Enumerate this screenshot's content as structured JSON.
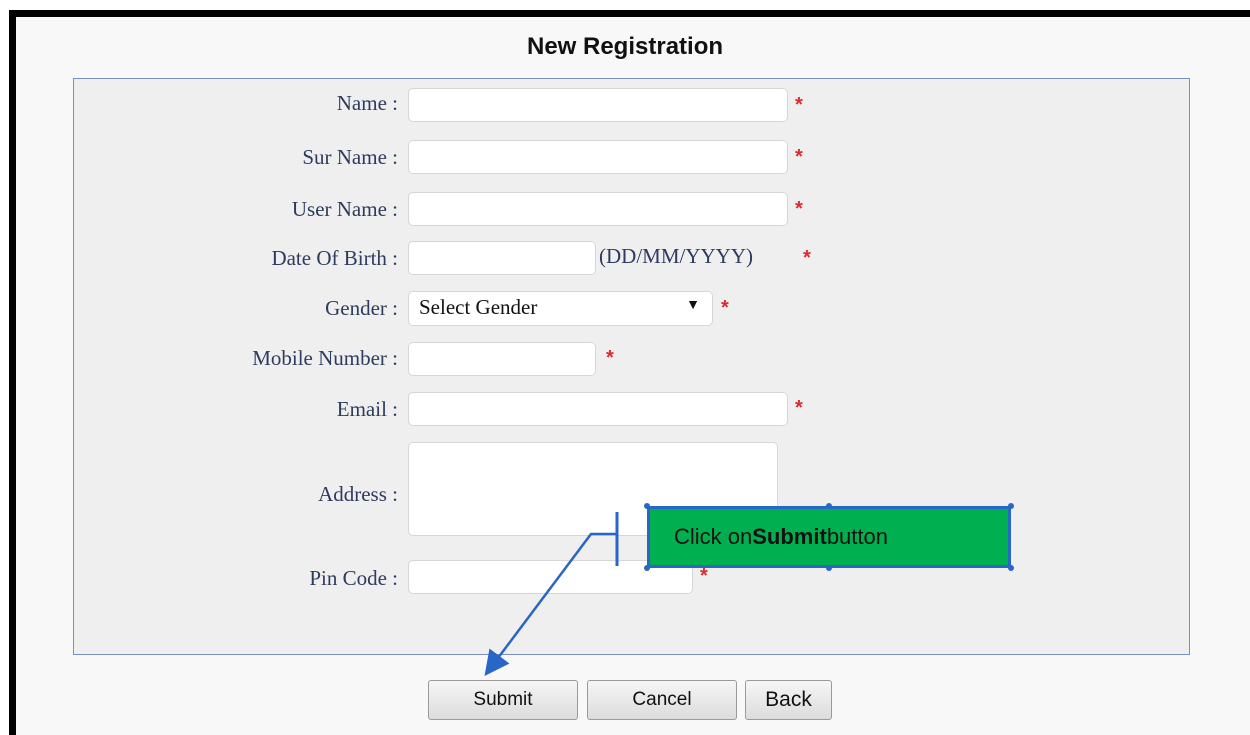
{
  "page": {
    "title": "New Registration"
  },
  "form": {
    "fields": {
      "name": {
        "label": "Name :",
        "value": ""
      },
      "surname": {
        "label": "Sur Name :",
        "value": ""
      },
      "username": {
        "label": "User Name :",
        "value": ""
      },
      "dob": {
        "label": "Date Of Birth :",
        "value": "",
        "hint": "(DD/MM/YYYY)"
      },
      "gender": {
        "label": "Gender :",
        "selected": "Select Gender"
      },
      "mobile": {
        "label": "Mobile Number :",
        "value": ""
      },
      "email": {
        "label": "Email :",
        "value": ""
      },
      "address": {
        "label": "Address :",
        "value": ""
      },
      "pincode": {
        "label": "Pin Code :",
        "value": ""
      }
    },
    "required_mark": "*"
  },
  "buttons": {
    "submit": "Submit",
    "cancel": "Cancel",
    "back": "Back"
  },
  "callout": {
    "prefix": "Click on ",
    "bold": "Submit",
    "suffix": " button"
  },
  "icons": {
    "dropdown": "chevron-down-icon"
  },
  "colors": {
    "required": "#e0282d",
    "callout_fill": "#00b050",
    "callout_border": "#2a65c8"
  }
}
